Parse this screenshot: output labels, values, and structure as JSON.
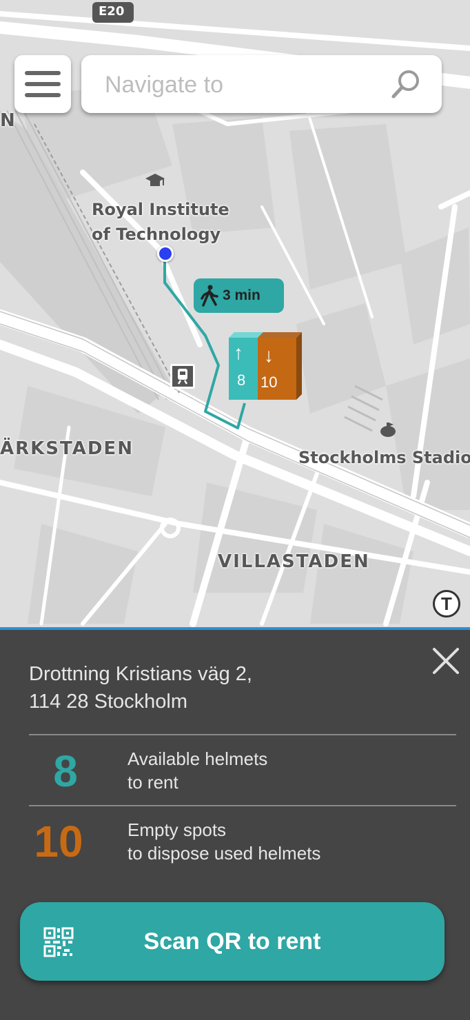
{
  "map": {
    "road_shield": "E20",
    "labels": {
      "campus": [
        "Royal Institute",
        "of Technology"
      ],
      "district_left": "ÄRKSTADEN",
      "stadium": "Stockholms Stadion",
      "district_bottom": "VILLASTADEN",
      "edge_letter": "N",
      "metro": "T"
    },
    "walk_time": "3 min",
    "station": {
      "up_arrow": "↑",
      "down_arrow": "↓",
      "available": "8",
      "empty": "10"
    }
  },
  "search": {
    "placeholder": "Navigate to"
  },
  "sheet": {
    "address_line1": "Drottning Kristians väg 2,",
    "address_line2": "114 28 Stockholm",
    "available": {
      "count": "8",
      "line1": "Available helmets",
      "line2": "to rent"
    },
    "empty": {
      "count": "10",
      "line1": "Empty spots",
      "line2": "to dispose used helmets"
    },
    "scan_label": "Scan QR to rent"
  },
  "colors": {
    "teal": "#2fa7a4",
    "orange": "#c86a14",
    "sheet_bg": "#454545",
    "route": "#2fa7a4",
    "location_dot": "#2b3ef0"
  },
  "icons": [
    "menu-icon",
    "search-icon",
    "graduation-cap-icon",
    "walking-person-icon",
    "train-icon",
    "stadium-icon",
    "metro-icon",
    "close-icon",
    "qr-code-icon"
  ]
}
